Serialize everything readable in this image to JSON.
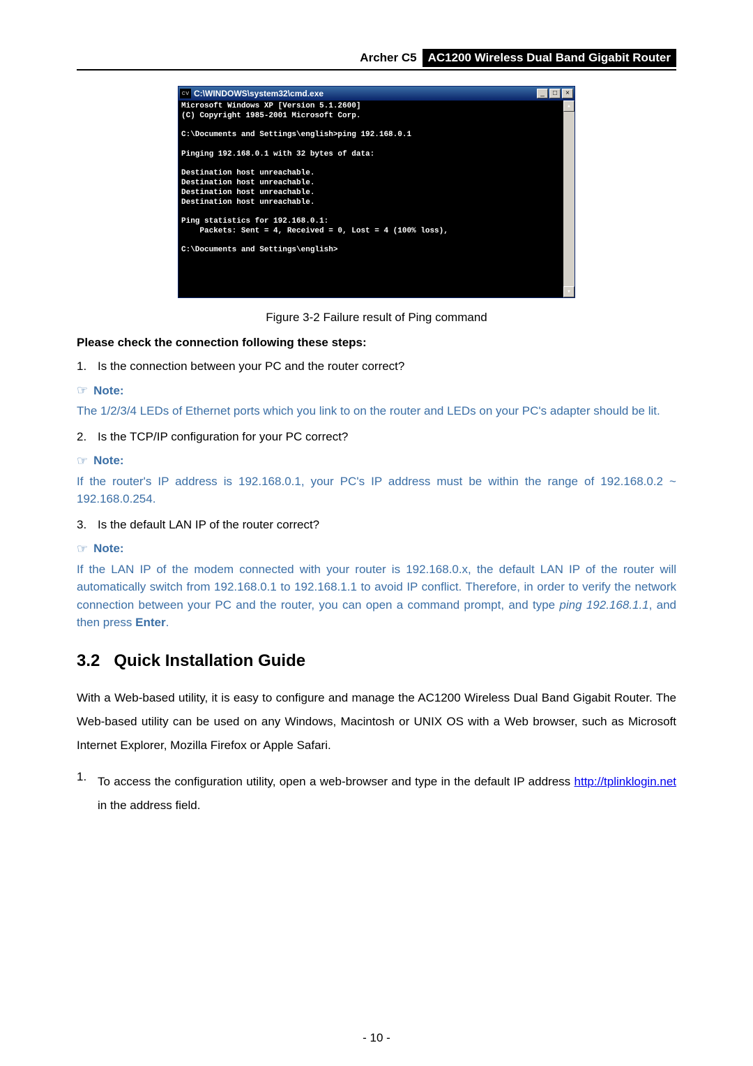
{
  "header": {
    "left": "Archer C5",
    "right": "AC1200 Wireless Dual Band Gigabit Router"
  },
  "cmd": {
    "icon": "cv",
    "title": "C:\\WINDOWS\\system32\\cmd.exe",
    "minimize": "_",
    "maximize": "□",
    "close": "×",
    "scroll_up": "▴",
    "scroll_down": "▾",
    "text": "Microsoft Windows XP [Version 5.1.2600]\n(C) Copyright 1985-2001 Microsoft Corp.\n\nC:\\Documents and Settings\\english>ping 192.168.0.1\n\nPinging 192.168.0.1 with 32 bytes of data:\n\nDestination host unreachable.\nDestination host unreachable.\nDestination host unreachable.\nDestination host unreachable.\n\nPing statistics for 192.168.0.1:\n    Packets: Sent = 4, Received = 0, Lost = 4 (100% loss),\n\nC:\\Documents and Settings\\english>"
  },
  "figure_caption": "Figure 3-2 Failure result of Ping command",
  "steps_intro": "Please check the connection following these steps:",
  "steps": {
    "s1_num": "1.",
    "s1_text": "Is the connection between your PC and the router correct?",
    "s2_num": "2.",
    "s2_text": "Is the TCP/IP configuration for your PC correct?",
    "s3_num": "3.",
    "s3_text": "Is the default LAN IP of the router correct?"
  },
  "note": {
    "icon": "☞",
    "label": "Note:",
    "note1": "The 1/2/3/4 LEDs of Ethernet ports which you link to on the router and LEDs on your PC's adapter should be lit.",
    "note2": "If the router's IP address is 192.168.0.1, your PC's IP address must be within the range of 192.168.0.2 ~ 192.168.0.254.",
    "note3_p1": "If the LAN IP of the modem connected with your router is 192.168.0.x, the default LAN IP of the router will automatically switch from 192.168.0.1 to 192.168.1.1 to avoid IP conflict. Therefore, in order to verify the network connection between your PC and the router, you can open a command prompt, and type ",
    "note3_italic": "ping 192.168.1.1",
    "note3_p2": ", and then press ",
    "note3_bold": "Enter",
    "note3_p3": "."
  },
  "section": {
    "num": "3.2",
    "title": "Quick Installation Guide",
    "para": "With a Web-based utility, it is easy to configure and manage the AC1200 Wireless Dual Band Gigabit Router. The Web-based utility can be used on any Windows, Macintosh or UNIX OS with a Web browser, such as Microsoft Internet Explorer, Mozilla Firefox or Apple Safari."
  },
  "config": {
    "num": "1.",
    "text_p1": "To access the configuration utility, open a web-browser and type in the default IP address ",
    "url": "http://tplinklogin.net",
    "text_p2": " in the address field."
  },
  "page_number": "- 10 -"
}
